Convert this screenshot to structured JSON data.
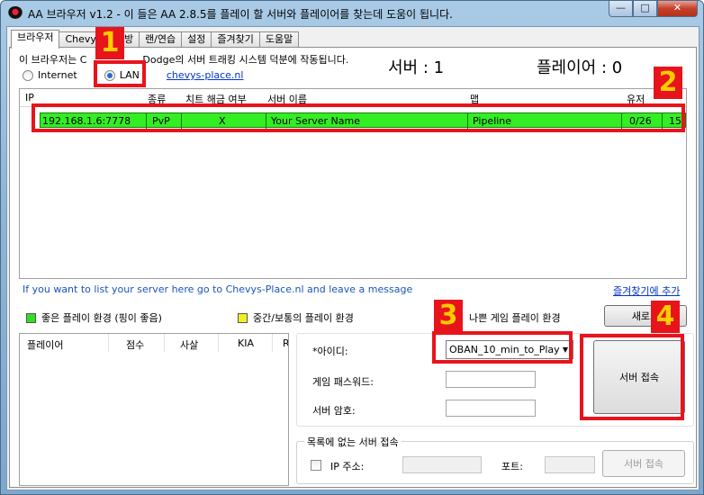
{
  "window": {
    "title": "AA 브라우저 v1.2 - 이 들은 AA 2.8.5를 플레이 할 서버와 플레이어를 찾는데 도움이 됩니다.",
    "controls": [
      "—",
      "□",
      "✕"
    ]
  },
  "tabs": [
    "브라우저",
    "Chevy",
    "방",
    "랜/연습",
    "설정",
    "즐겨찾기",
    "도움말"
  ],
  "browser": {
    "info_prefix": "이 브라우저는 C",
    "info_suffix": "Dodge의 서버 트래킹 시스템 덕분에 작동됩니다.",
    "radio_internet": "Internet",
    "radio_lan": "LAN",
    "site_link": "chevys-place.nl",
    "servers_label": "서버 : 1",
    "players_label": "플레이어 : 0"
  },
  "server_list": {
    "columns": [
      "IP",
      "종류",
      "치트 해금 여부",
      "서버 이름",
      "맵",
      "유저"
    ],
    "rows": [
      {
        "ip": "192.168.1.6:7778",
        "type": "PvP",
        "cheats": "X",
        "name": "Your Server Name",
        "map": "Pipeline",
        "users": "0/26",
        "ping": "15"
      }
    ]
  },
  "footer": {
    "note": "If you want to list your server here go to Chevys-Place.nl and leave a message",
    "favorite_link": "즐겨찾기에 추가"
  },
  "legend": {
    "good": "좋은 플레이 환경 (핑이 좋음)",
    "medium": "중간/보통의 플레이 환경",
    "bad": "나쁜 게임 플레이 환경",
    "good_color": "#33dd22",
    "medium_color": "#f0f022",
    "bad_color": "#e83030"
  },
  "refresh_button": "새로고",
  "players_table": {
    "columns": [
      "플레이어",
      "점수",
      "사살",
      "KIA",
      "R"
    ]
  },
  "login": {
    "id_label": "*아이디:",
    "id_value": "OBAN_10_min_to_Play",
    "game_password_label": "게임 패스워드:",
    "server_password_label": "서버 암호:",
    "connect_button": "서버 접속"
  },
  "direct_connect": {
    "title": "목록에 없는 서버 접속",
    "ip_label": "IP 주소:",
    "port_label": "포트:",
    "connect_button": "서버 접속"
  },
  "annotations": [
    "1",
    "2",
    "3",
    "4"
  ]
}
